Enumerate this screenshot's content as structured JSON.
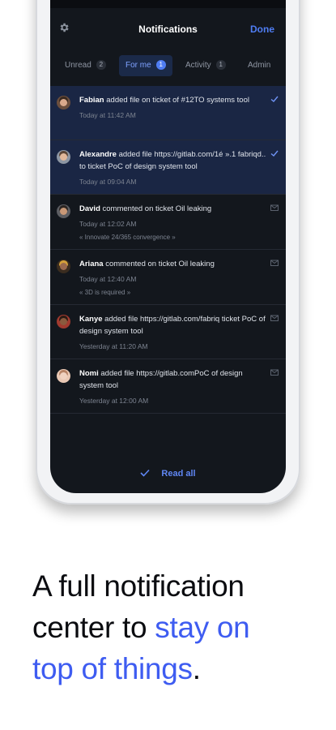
{
  "header": {
    "title": "Notifications",
    "done_label": "Done"
  },
  "tabs": [
    {
      "label": "Unread",
      "count": "2"
    },
    {
      "label": "For me",
      "count": "1"
    },
    {
      "label": "Activity",
      "count": "1"
    },
    {
      "label": "Admin"
    }
  ],
  "notifications": [
    {
      "actor": "Fabian",
      "action": " added file on ticket of #12TO systems tool",
      "time": "Today at 11:42 AM"
    },
    {
      "actor": "Alexandre",
      "action": " added file https://gitlab.com/1é ».1 fabriqd.. to ticket PoC of design system tool",
      "time": "Today at 09:04 AM"
    },
    {
      "actor": "David",
      "action": " commented on ticket Oil leaking",
      "time": "Today at 12:02 AM",
      "context": "« Innovate 24/365 convergence »"
    },
    {
      "actor": "Ariana",
      "action": " commented on ticket Oil leaking",
      "time": "Today at 12:40 AM",
      "context": "« 3D is required »"
    },
    {
      "actor": "Kanye",
      "action": " added file https://gitlab.com/fabriq ticket PoC of design system tool",
      "time": "Yesterday at 11:20 AM"
    },
    {
      "actor": "Nomi",
      "action": " added file https://gitlab.comPoC of design system tool",
      "time": "Yesterday at 12:00 AM"
    }
  ],
  "footer": {
    "read_all_label": "Read all"
  },
  "marketing": {
    "line1": "A full notification",
    "line2_plain": "center to ",
    "line2_accent": "stay on",
    "line3_accent": "top of things",
    "line3_plain": "."
  },
  "colors": {
    "accent": "#4f7df3",
    "headline_accent": "#3e5cf1",
    "screen_bg": "#13171d",
    "unread_bg": "#1a2644"
  }
}
